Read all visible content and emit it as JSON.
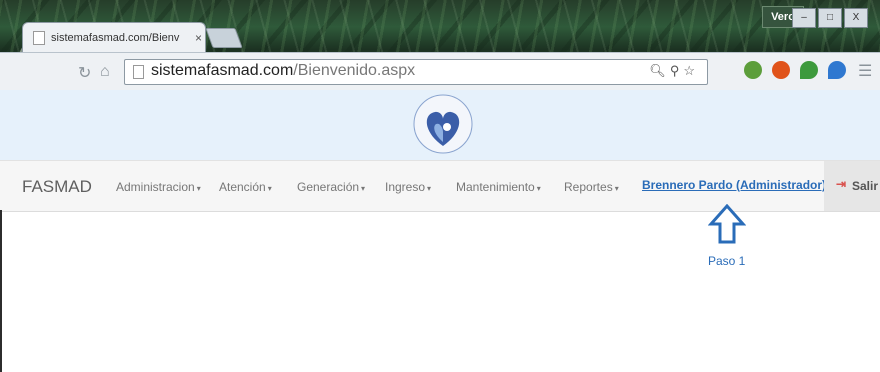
{
  "browser": {
    "tab_title": "sistemafasmad.com/Bienv",
    "tab_close": "×",
    "user_badge": "Vero",
    "url_domain": "sistemafasmad.com",
    "url_path": "/Bienvenido.aspx",
    "window_controls": [
      "–",
      "□",
      "X"
    ]
  },
  "navbar": {
    "brand": "FASMAD",
    "menus": [
      "Administracion",
      "Atención",
      "Generación",
      "Ingreso",
      "Mantenimiento",
      "Reportes"
    ],
    "caret": "▾",
    "user": "Brennero Pardo (Administrador)",
    "logout": "Salir"
  },
  "annotation": {
    "label": "Paso 1",
    "color": "#2a6cb8"
  }
}
